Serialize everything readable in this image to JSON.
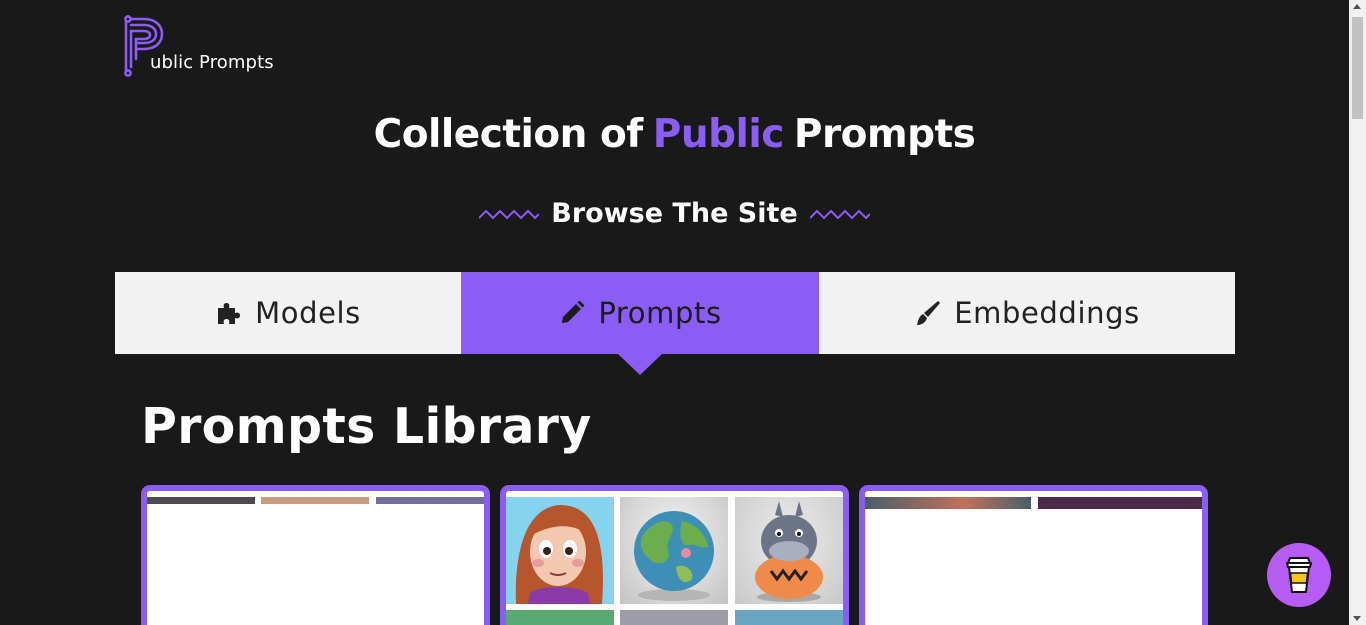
{
  "logo": {
    "text": "ublic Prompts",
    "icon": "p-logo-icon"
  },
  "hero": {
    "title_pre": "Collection of",
    "title_accent": "Public",
    "title_post": "Prompts",
    "browse_label": "Browse The Site"
  },
  "tabs": [
    {
      "label": "Models",
      "icon": "puzzle-icon",
      "active": false
    },
    {
      "label": "Prompts",
      "icon": "pencil-icon",
      "active": true
    },
    {
      "label": "Embeddings",
      "icon": "brush-icon",
      "active": false
    }
  ],
  "library": {
    "title": "Prompts Library"
  },
  "colors": {
    "background": "#1a191a",
    "accent": "#8b5cf6",
    "tab_inactive": "#f2f2f2",
    "coffee_button": "#b45cf4"
  },
  "floating": {
    "icon": "coffee-cup-icon"
  }
}
